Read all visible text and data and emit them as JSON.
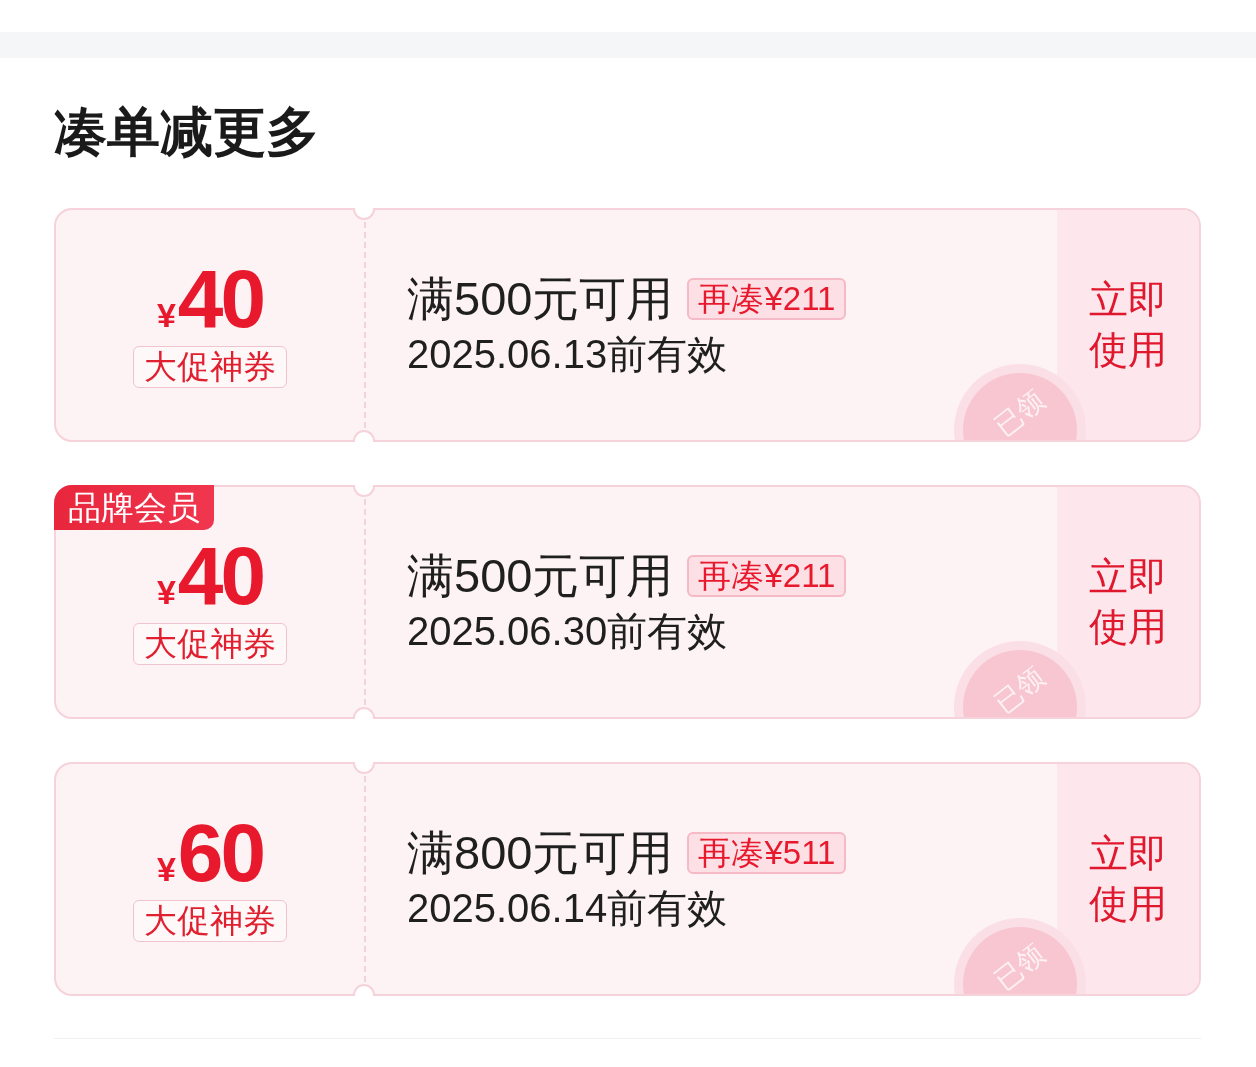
{
  "title": "凑单减更多",
  "coupons": [
    {
      "currency": "¥",
      "amount": "40",
      "label": "大促神券",
      "condition": "满500元可用",
      "top_up": "再凑¥211",
      "expiry": "2025.06.13前有效",
      "action": "立即使用",
      "claimed": true,
      "stamp": "已领"
    },
    {
      "badge": "品牌会员",
      "currency": "¥",
      "amount": "40",
      "label": "大促神券",
      "condition": "满500元可用",
      "top_up": "再凑¥211",
      "expiry": "2025.06.30前有效",
      "action": "立即使用",
      "claimed": true,
      "stamp": "已领"
    },
    {
      "currency": "¥",
      "amount": "60",
      "label": "大促神券",
      "condition": "满800元可用",
      "top_up": "再凑¥511",
      "expiry": "2025.06.14前有效",
      "action": "立即使用",
      "claimed": true,
      "stamp": "已领"
    }
  ]
}
